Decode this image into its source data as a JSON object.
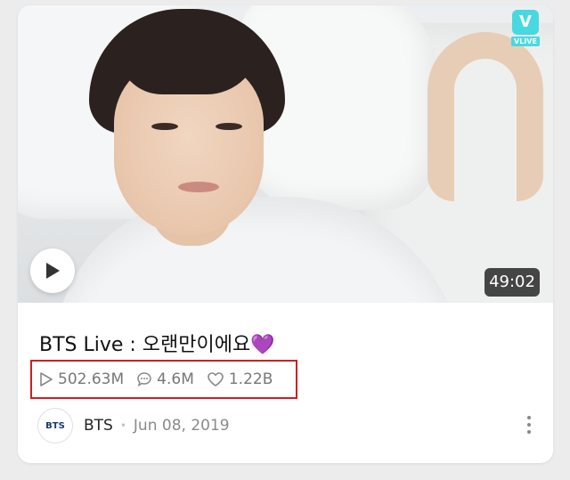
{
  "video": {
    "duration": "49:02",
    "title": "BTS Live : 오랜만이에요",
    "title_emoji": "💜",
    "stats": {
      "plays": "502.63M",
      "comments": "4.6M",
      "likes": "1.22B"
    }
  },
  "badge": {
    "brand_mark": "V",
    "brand_text": "VLIVE",
    "color": "#48d9e0"
  },
  "channel": {
    "avatar_text": "BTS",
    "name": "BTS",
    "separator": "•",
    "date": "Jun 08, 2019"
  },
  "icons": {
    "play": "play-icon",
    "views": "play-outline-icon",
    "comments": "comment-icon",
    "likes": "heart-icon",
    "more": "more-vertical-icon"
  },
  "colors": {
    "highlight_border": "#d21e1e",
    "heart": "#a23bd8"
  }
}
